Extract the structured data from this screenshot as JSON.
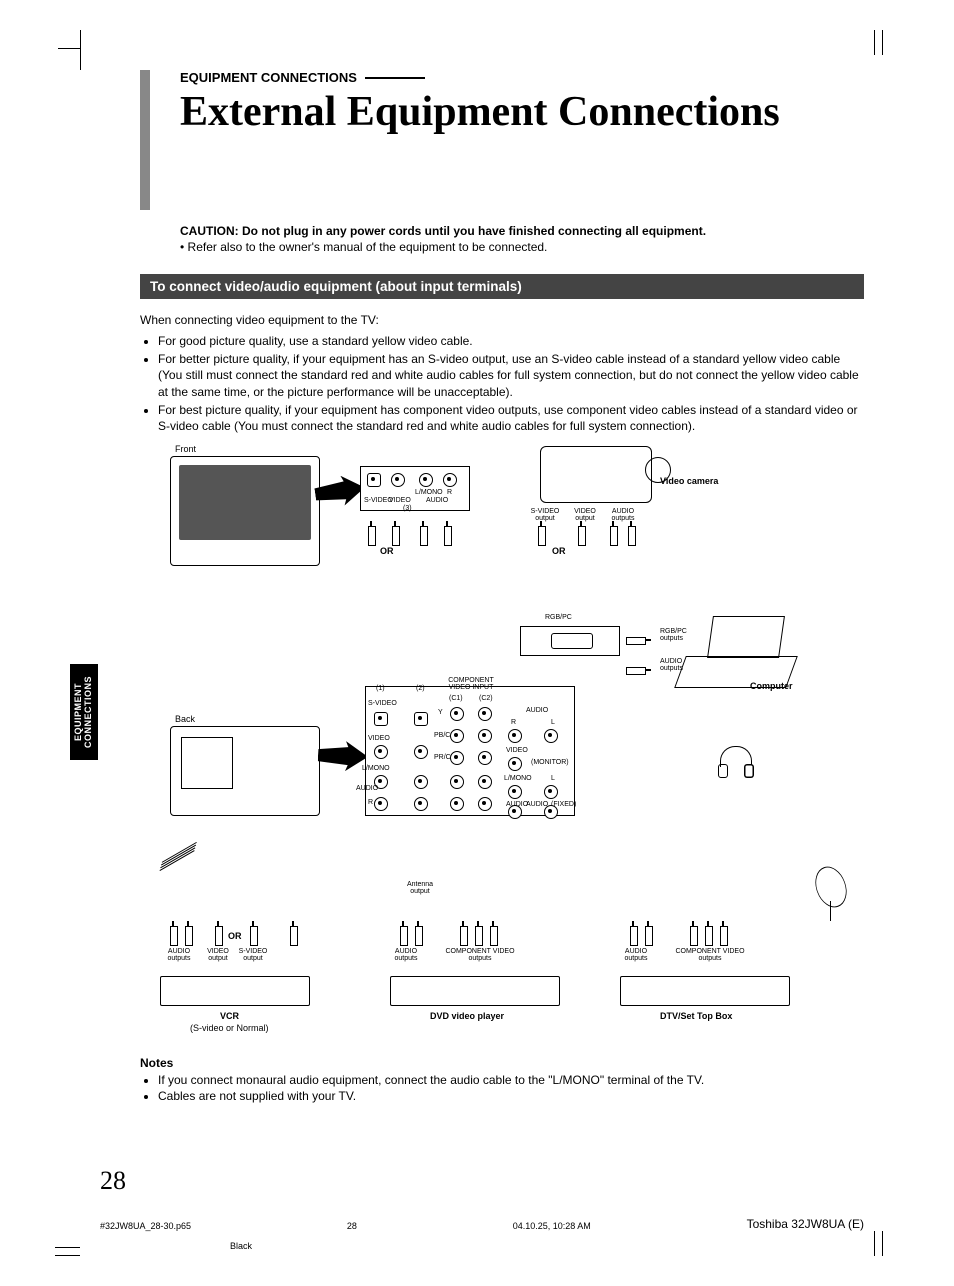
{
  "eyebrow": "EQUIPMENT CONNECTIONS",
  "title": "External Equipment Connections",
  "caution": "CAUTION: Do not plug in any power cords until you have finished connecting all equipment.",
  "refer": "Refer also to the owner's manual of the equipment to be connected.",
  "section_title": "To connect video/audio equipment (about input terminals)",
  "intro": "When connecting video equipment to the TV:",
  "bullets": [
    "For good picture quality, use a standard yellow video cable.",
    "For better picture quality, if your equipment has an S-video output, use an S-video cable instead of a standard yellow video cable (You still must connect the standard red and white audio cables for full system connection, but do not connect the yellow video cable at the same time, or the picture performance will be unacceptable).",
    "For best picture quality, if your equipment has component video outputs, use component video cables instead of a standard video or S-video cable (You must connect the standard red and white audio cables for full system connection)."
  ],
  "diagram": {
    "front_label": "Front",
    "back_label": "Back",
    "video_camera": "Video camera",
    "computer": "Computer",
    "or": "OR",
    "svideo": "S-VIDEO",
    "video": "VIDEO",
    "audio": "AUDIO",
    "lmono": "L/MONO",
    "r": "R",
    "l": "L",
    "input3": "(3)",
    "svideo_output": "S-VIDEO output",
    "video_output": "VIDEO output",
    "audio_outputs": "AUDIO outputs",
    "rgbpc": "RGB/PC",
    "rgbpc_outputs": "RGB/PC outputs",
    "component_video_input": "COMPONENT VIDEO INPUT",
    "c1": "(C1)",
    "c2": "(C2)",
    "in1": "(1)",
    "in2": "(2)",
    "y": "Y",
    "pb": "PB/CB",
    "pr": "PR/CR",
    "monitor": "(MONITOR)",
    "fixed": "(FIXED)",
    "antenna_output": "Antenna output",
    "component_video": "COMPONENT VIDEO",
    "component_video_outputs": "COMPONENT VIDEO outputs",
    "vcr": "VCR",
    "vcr_sub": "(S-video or Normal)",
    "dvd": "DVD video player",
    "stb": "DTV/Set Top Box"
  },
  "notes_head": "Notes",
  "notes": [
    "If you connect monaural audio equipment, connect the audio cable to the \"L/MONO\" terminal of  the TV.",
    "Cables are not supplied with your TV."
  ],
  "side_tab_line1": "EQUIPMENT",
  "side_tab_line2": "CONNECTIONS",
  "page_number": "28",
  "footer_file": "#32JW8UA_28-30.p65",
  "footer_page": "28",
  "footer_date": "04.10.25, 10:28 AM",
  "footer_model": "Toshiba 32JW8UA (E)",
  "footer_black": "Black"
}
